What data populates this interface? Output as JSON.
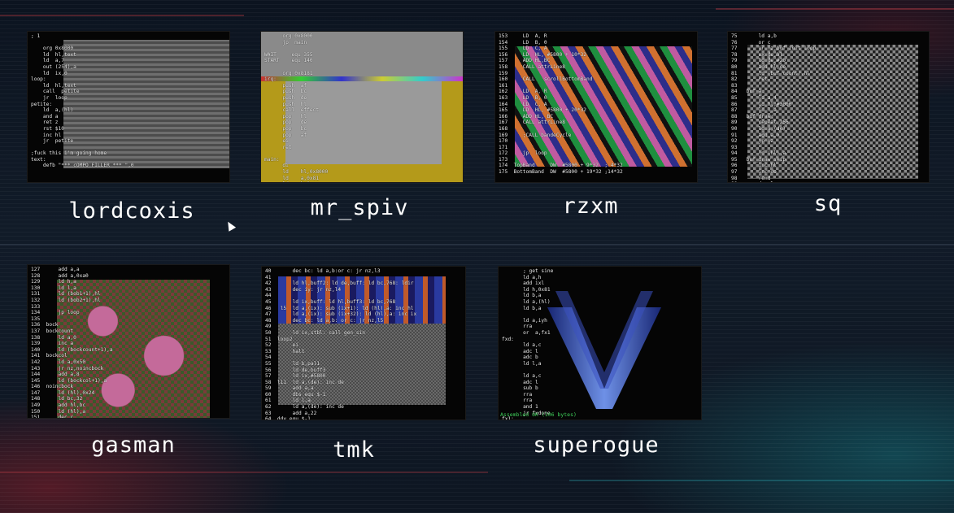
{
  "entries": [
    {
      "name": "lordcoxis",
      "code": "; 1\n\n    org 0x8000\n    ld  hl,text\n    ld  a,7\n    out (254),a\n    ld  ix,0\nloop:\n    ld  hl,text\n    call  petite\n    jr  loop\npetite:\n    ld  a,(hl)\n    and a\n    ret z\n    rst $10\n    inc hl\n    jr  petite\n\n;fuck this i'm going home\ntext:\n    defb \"*** cOMPO FILLER *** \",0"
    },
    {
      "name": "mr_spiv",
      "code": "      org 0x8000\n      jp  main\n\nWAIT     equ 355\nSTART    equ 140\n\n      org 0x8181\nirq:\n      push  af\n      push  bc\n      push  de\n      push  hl\n      call  effect\n      pop   hl\n      pop   de\n      pop   bc\n      pop   af\n      ei\n      ret\n\nmain:\n      di\n      ld    hl,0x8000\n      ld    a,0x81\n      ld    b,0"
    },
    {
      "name": "rzxm",
      "code": "153     LD  A, R\n154     LD  B, 0\n155     LD  C, A\n156     LD  HL, #5800 + 10*32\n157     ADD HL,BC\n158     CALL attrLine8\n159\n160     CALL   scrollBottomBand\n161\n162     LD  A, R\n163     LD  B, 0\n164     LD  C, A\n165     LD  HL, #5800 + 20*32\n166     ADD HL, BC\n167     CALL attrLine8\n168\n169     ;CALL bandeCycle\n170\n171\n172     jp  loop\n173\n174  TopBand     DW  #5800 + 9*32  ; 4*32\n175  BottomBand  DW  #5800 + 19*32 ;14*32"
    },
    {
      "name": "sq",
      "code": "75       ld a,b\n76       or c\n77       jr nz,buf_init_loop\n78       ex de,hl\n79       ld de,#20\n80       add hl,de\n81       ld (buf_count),hl\n82       ret\n83\n84   buf_a:\n85       ld a,4\n86       ld hl,#3000\n87       ld l,a\n88   buf_draw:\n89       repeat 256\n90       ld a,(de)\n91       add a,h\n92       jp nz\n93\n94       ld (hl),a\n95   buf_draw_skip\n96       inc hl\n97       inc de\n98       rend\n99       dec lx\n100      jp nz,buf_draw"
    },
    {
      "name": "gasman",
      "code": "127      add a,a\n128      add a,0xa0\n129      ld h,a\n130      ld l,a\n131      ld (bob1+1),hl\n132      ld (bob2+1),hl\n133\n134      jp loop\n135\n136  bock\n137  bockcount\n138      ld a,0\n139      inc a\n140      ld (bockcount+1),a\n141  bockcol\n142      ld a,0x50\n143      jr nz,noincbock\n144      add a,8\n145      ld (bockcol+1),a\n146  noincbock\n147      ld (hl),0x24\n148      ld bc,32\n149      add hl,bc\n150      ld (hl),a\n151      dec c\n152      add hl,bc"
    },
    {
      "name": "tmk",
      "code": "40       dec bc: ld a,b:or c: jr nz,l3\n41\n42       ld hl,buff2: ld de,buff: ld bc,768: ldir\n43       dec iy: jr nz,l4\n44\n45       ld ix,buff: ld hl,buff3: ld bc,768\n46   l5  ld a,(ix): sub (ix+1): ld (hl),a: inc hl\n47       ld a,(ix): sub (ix+32): ld (hl),a: inc ix\n48       dec bc: ld a,b: or c: jr nz,l5\n49\n50       ld ix,stbl: call gen_sin\n51  loop2\n52       ei\n53       halt\n54\n55       ld b,pal1\n56       ld de,buff3\n57       ld ix,#5800\n58  l11  ld a,(de): inc de\n59       add a,a\n60       dbs equ $-1\n61       ld l,a\n62       ld a,(de): inc de\n63       add a,22\n64  ddy equ $-1\n65       or #c0"
    },
    {
      "name": "superogue",
      "code": "       ; get sine\n       ld a,h\n       add ixl\n       ld h,0x81\n       ld b,a\n       ld a,(hl)\n       ld b,a\n\n       ld a,iyh\n       rra\n       or  a,fx1\nfxd:\n       ld a,c\n       adc l\n       adc b\n       ld l,a\n\n       ld a,c\n       adc l\n       sub b\n       rra\n       rra\n       and 1\n       jr fxdone\nfx1:",
      "status": "Assembled OK (106 bytes)"
    }
  ]
}
